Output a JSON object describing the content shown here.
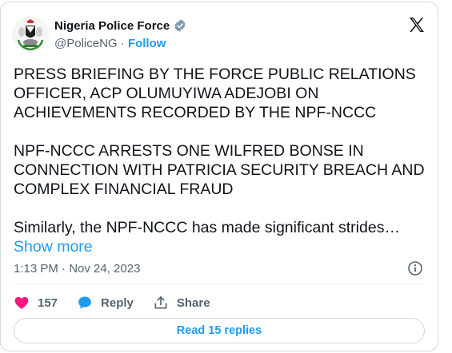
{
  "tweet": {
    "author_name": "Nigeria Police Force",
    "handle": "@PoliceNG",
    "separator": " · ",
    "follow_label": "Follow",
    "paragraph1": "PRESS BRIEFING BY THE FORCE PUBLIC RELATIONS OFFICER, ACP OLUMUYIWA ADEJOBI ON ACHIEVEMENTS RECORDED BY THE NPF-NCCC",
    "paragraph2": "NPF-NCCC ARRESTS ONE WILFRED BONSE IN CONNECTION WITH PATRICIA SECURITY BREACH AND COMPLEX FINANCIAL FRAUD",
    "paragraph3": "Similarly, the NPF-NCCC has made significant strides…",
    "show_more_label": "Show more",
    "timestamp": "1:13 PM · Nov 24, 2023"
  },
  "actions": {
    "like_count": "157",
    "reply_label": "Reply",
    "share_label": "Share"
  },
  "read_replies_label": "Read 15 replies",
  "icons": {
    "avatar": "police-crest-icon",
    "verified": "verified-badge-icon",
    "logo": "x-logo-icon",
    "info": "info-icon",
    "like": "heart-icon",
    "reply": "speech-bubble-icon",
    "share": "share-upload-icon"
  },
  "colors": {
    "accent": "#1d9bf0",
    "like": "#f91880",
    "text": "#0f1419",
    "muted": "#536471",
    "border": "#cfd9de"
  }
}
